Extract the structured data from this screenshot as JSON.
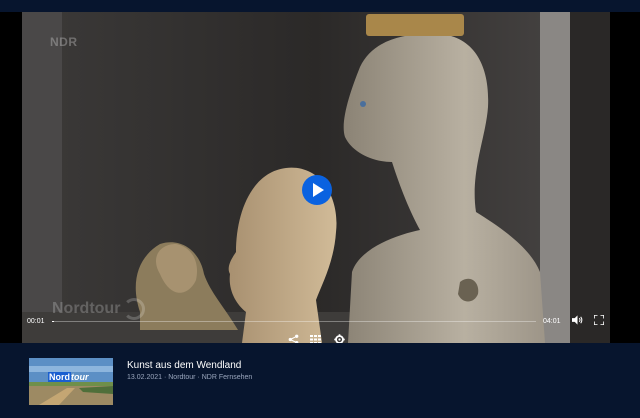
{
  "player": {
    "channel_logo": "NDR",
    "watermark": "Nordtour",
    "current_time": "00:01",
    "total_time": "04:01",
    "progress": 0.004,
    "icons": {
      "play": "play-icon",
      "share": "share-icon",
      "chapters": "grid-icon",
      "settings": "gear-icon",
      "volume": "volume-icon",
      "fullscreen": "fullscreen-icon"
    }
  },
  "info": {
    "thumbnail_label_1": "Nord",
    "thumbnail_label_2": "tour",
    "title": "Kunst aus dem Wendland",
    "meta": "13.02.2021 · Nordtour · NDR Fernsehen"
  },
  "colors": {
    "background": "#07152e",
    "accent": "#0a62e0"
  }
}
